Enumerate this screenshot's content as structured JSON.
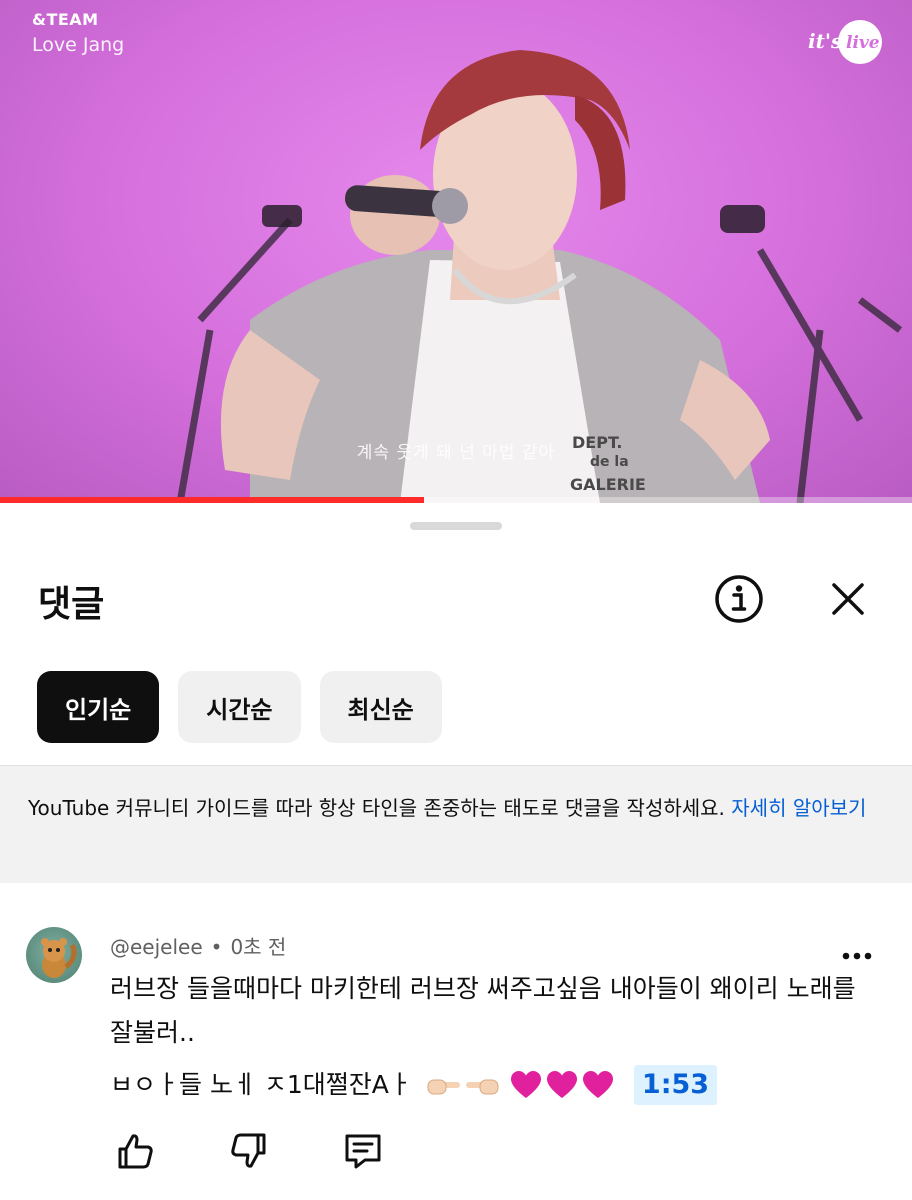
{
  "video": {
    "artist": "&TEAM",
    "song": "Love Jang",
    "logo_text": "it's live",
    "caption": "계속 웃게 돼 넌 마법 같아",
    "progress": 0.465,
    "colors": {
      "background": "#d56fdc",
      "progress": "#ff2a2a"
    }
  },
  "comments_sheet": {
    "title": "댓글",
    "info_icon": "info-circle-icon",
    "close_icon": "close-icon",
    "sort_chips": [
      {
        "label": "인기순",
        "active": true
      },
      {
        "label": "시간순",
        "active": false
      },
      {
        "label": "최신순",
        "active": false
      }
    ],
    "guideline": {
      "text": "YouTube 커뮤니티 가이드를 따라 항상 타인을 존중하는 태도로 댓글을 작성하세요. ",
      "link": "자세히 알아보기"
    },
    "comment": {
      "author": "@eejelee",
      "separator": "•",
      "time": "0초 전",
      "line1": "러브장 들을때마다 마키한테 러브장 써주고싶음 내아들이 왜이리 노래를 잘불러..",
      "line3_text": "ㅂㅇㅏ들 노ㅔ ㅈ1대쩔잔Aㅏ",
      "emoji_icons": [
        "pointing-hand-right-icon",
        "pointing-hand-left-icon",
        "heart-icon",
        "heart-icon",
        "heart-icon"
      ],
      "timestamp": "1:53",
      "actions": [
        "like-icon",
        "dislike-icon",
        "reply-icon"
      ]
    }
  }
}
